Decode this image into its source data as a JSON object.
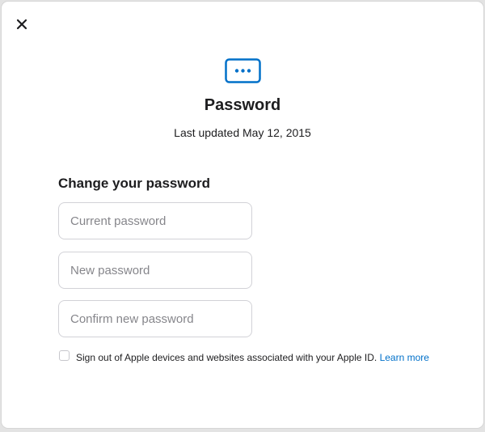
{
  "header": {
    "close_icon": "close-icon",
    "password_icon": "password-dots-icon",
    "title": "Password",
    "subtitle": "Last updated May 12, 2015"
  },
  "form": {
    "section_title": "Change your password",
    "current_password": {
      "placeholder": "Current password",
      "value": ""
    },
    "new_password": {
      "placeholder": "New password",
      "value": ""
    },
    "confirm_password": {
      "placeholder": "Confirm new password",
      "value": ""
    },
    "signout_checkbox": {
      "checked": false,
      "label": "Sign out of Apple devices and websites associated with your Apple ID.",
      "link_text": "Learn more"
    }
  },
  "colors": {
    "accent": "#0070c9",
    "text": "#1d1d1f",
    "placeholder": "#86868b",
    "border": "#d2d2d7"
  }
}
